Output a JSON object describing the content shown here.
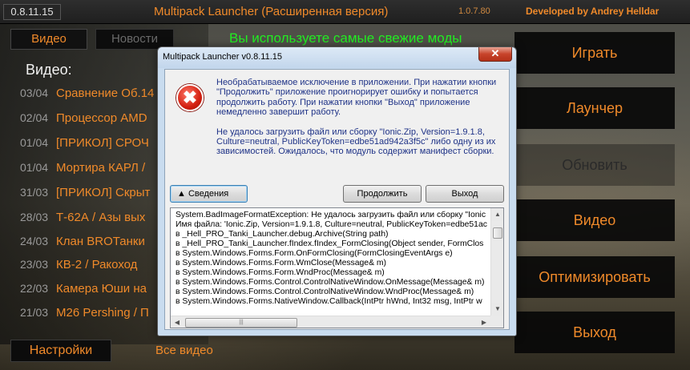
{
  "titlebar": {
    "version": "0.8.11.15",
    "title": "Multipack Launcher (Расширенная версия)",
    "build": "1.0.7.80",
    "developer": "Developed by Andrey Helldar"
  },
  "tabs": [
    {
      "label": "Видео",
      "active": true
    },
    {
      "label": "Новости",
      "active": false
    }
  ],
  "update_message": "Вы используете самые свежие моды",
  "video_heading": "Видео:",
  "videos": [
    {
      "date": "03/04",
      "title": "Сравнение Об.14"
    },
    {
      "date": "02/04",
      "title": "Процессор AMD"
    },
    {
      "date": "01/04",
      "title": "[ПРИКОЛ] СРОЧ"
    },
    {
      "date": "01/04",
      "title": "Мортира КАРЛ /"
    },
    {
      "date": "31/03",
      "title": "[ПРИКОЛ] Скрыт"
    },
    {
      "date": "28/03",
      "title": "Т-62А / Азы вых"
    },
    {
      "date": "24/03",
      "title": "Клан BROТанки"
    },
    {
      "date": "23/03",
      "title": "КВ-2 / Ракоход"
    },
    {
      "date": "22/03",
      "title": "Камера Юши на"
    },
    {
      "date": "21/03",
      "title": "M26 Pershing / П"
    }
  ],
  "footer": {
    "settings_label": "Настройки",
    "all_videos_label": "Все видео"
  },
  "right_buttons": [
    {
      "label": "Играть",
      "enabled": true
    },
    {
      "label": "Лаунчер",
      "enabled": true
    },
    {
      "label": "Обновить",
      "enabled": false
    },
    {
      "label": "Видео",
      "enabled": true
    },
    {
      "label": "Оптимизировать",
      "enabled": true
    },
    {
      "label": "Выход",
      "enabled": true
    }
  ],
  "dialog": {
    "title": "Multipack Launcher v0.8.11.15",
    "close_glyph": "✕",
    "error_glyph": "✖",
    "message_1": "Необрабатываемое исключение в приложении. При нажатии кнопки \"Продолжить\" приложение проигнорирует ошибку и попытается продолжить работу. При нажатии кнопки \"Выход\" приложение немедленно завершит работу.",
    "message_2": "Не удалось загрузить файл или сборку \"Ionic.Zip, Version=1.9.1.8, Culture=neutral, PublicKeyToken=edbe51ad942a3f5c\" либо одну из их зависимостей. Ожидалось, что модуль содержит манифест сборки.",
    "details_label": "▲ Сведения",
    "continue_label": "Продолжить",
    "exit_label": "Выход",
    "trace_lines": [
      "System.BadImageFormatException: Не удалось загрузить файл или сборку \"Ionic",
      "Имя файла: 'Ionic.Zip, Version=1.9.1.8, Culture=neutral, PublicKeyToken=edbe51ac",
      "   в _Hell_PRO_Tanki_Launcher.debug.Archive(String path)",
      "   в _Hell_PRO_Tanki_Launcher.fIndex.fIndex_FormClosing(Object sender, FormClos",
      "   в System.Windows.Forms.Form.OnFormClosing(FormClosingEventArgs e)",
      "   в System.Windows.Forms.Form.WmClose(Message& m)",
      "   в System.Windows.Forms.Form.WndProc(Message& m)",
      "   в System.Windows.Forms.Control.ControlNativeWindow.OnMessage(Message& m)",
      "   в System.Windows.Forms.Control.ControlNativeWindow.WndProc(Message& m)",
      "   в System.Windows.Forms.NativeWindow.Callback(IntPtr hWnd, Int32 msg, IntPtr w"
    ],
    "scroll_up": "▲",
    "scroll_down": "▼",
    "scroll_left": "◀",
    "scroll_right": "▶",
    "hscroll_grip": "|||"
  }
}
